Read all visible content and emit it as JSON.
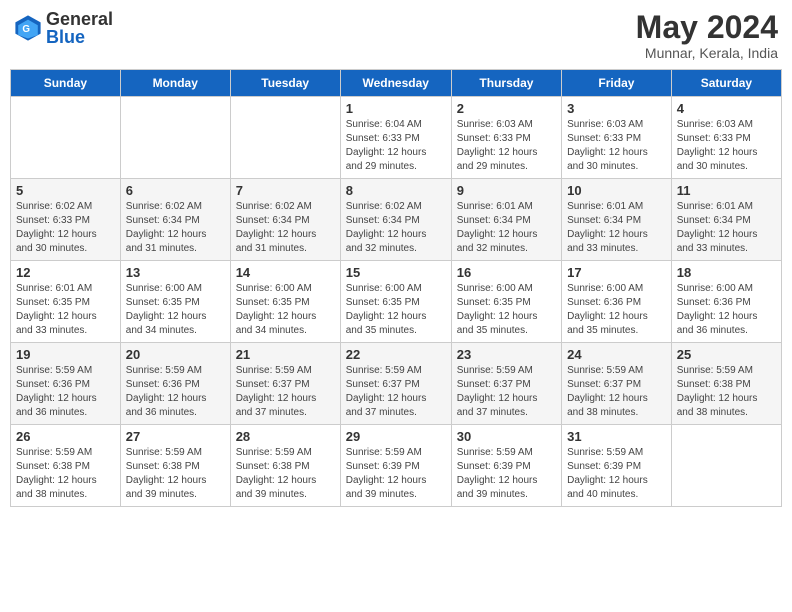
{
  "header": {
    "logo_general": "General",
    "logo_blue": "Blue",
    "month": "May 2024",
    "location": "Munnar, Kerala, India"
  },
  "weekdays": [
    "Sunday",
    "Monday",
    "Tuesday",
    "Wednesday",
    "Thursday",
    "Friday",
    "Saturday"
  ],
  "weeks": [
    [
      {
        "day": "",
        "sunrise": "",
        "sunset": "",
        "daylight": ""
      },
      {
        "day": "",
        "sunrise": "",
        "sunset": "",
        "daylight": ""
      },
      {
        "day": "",
        "sunrise": "",
        "sunset": "",
        "daylight": ""
      },
      {
        "day": "1",
        "sunrise": "Sunrise: 6:04 AM",
        "sunset": "Sunset: 6:33 PM",
        "daylight": "Daylight: 12 hours and 29 minutes."
      },
      {
        "day": "2",
        "sunrise": "Sunrise: 6:03 AM",
        "sunset": "Sunset: 6:33 PM",
        "daylight": "Daylight: 12 hours and 29 minutes."
      },
      {
        "day": "3",
        "sunrise": "Sunrise: 6:03 AM",
        "sunset": "Sunset: 6:33 PM",
        "daylight": "Daylight: 12 hours and 30 minutes."
      },
      {
        "day": "4",
        "sunrise": "Sunrise: 6:03 AM",
        "sunset": "Sunset: 6:33 PM",
        "daylight": "Daylight: 12 hours and 30 minutes."
      }
    ],
    [
      {
        "day": "5",
        "sunrise": "Sunrise: 6:02 AM",
        "sunset": "Sunset: 6:33 PM",
        "daylight": "Daylight: 12 hours and 30 minutes."
      },
      {
        "day": "6",
        "sunrise": "Sunrise: 6:02 AM",
        "sunset": "Sunset: 6:34 PM",
        "daylight": "Daylight: 12 hours and 31 minutes."
      },
      {
        "day": "7",
        "sunrise": "Sunrise: 6:02 AM",
        "sunset": "Sunset: 6:34 PM",
        "daylight": "Daylight: 12 hours and 31 minutes."
      },
      {
        "day": "8",
        "sunrise": "Sunrise: 6:02 AM",
        "sunset": "Sunset: 6:34 PM",
        "daylight": "Daylight: 12 hours and 32 minutes."
      },
      {
        "day": "9",
        "sunrise": "Sunrise: 6:01 AM",
        "sunset": "Sunset: 6:34 PM",
        "daylight": "Daylight: 12 hours and 32 minutes."
      },
      {
        "day": "10",
        "sunrise": "Sunrise: 6:01 AM",
        "sunset": "Sunset: 6:34 PM",
        "daylight": "Daylight: 12 hours and 33 minutes."
      },
      {
        "day": "11",
        "sunrise": "Sunrise: 6:01 AM",
        "sunset": "Sunset: 6:34 PM",
        "daylight": "Daylight: 12 hours and 33 minutes."
      }
    ],
    [
      {
        "day": "12",
        "sunrise": "Sunrise: 6:01 AM",
        "sunset": "Sunset: 6:35 PM",
        "daylight": "Daylight: 12 hours and 33 minutes."
      },
      {
        "day": "13",
        "sunrise": "Sunrise: 6:00 AM",
        "sunset": "Sunset: 6:35 PM",
        "daylight": "Daylight: 12 hours and 34 minutes."
      },
      {
        "day": "14",
        "sunrise": "Sunrise: 6:00 AM",
        "sunset": "Sunset: 6:35 PM",
        "daylight": "Daylight: 12 hours and 34 minutes."
      },
      {
        "day": "15",
        "sunrise": "Sunrise: 6:00 AM",
        "sunset": "Sunset: 6:35 PM",
        "daylight": "Daylight: 12 hours and 35 minutes."
      },
      {
        "day": "16",
        "sunrise": "Sunrise: 6:00 AM",
        "sunset": "Sunset: 6:35 PM",
        "daylight": "Daylight: 12 hours and 35 minutes."
      },
      {
        "day": "17",
        "sunrise": "Sunrise: 6:00 AM",
        "sunset": "Sunset: 6:36 PM",
        "daylight": "Daylight: 12 hours and 35 minutes."
      },
      {
        "day": "18",
        "sunrise": "Sunrise: 6:00 AM",
        "sunset": "Sunset: 6:36 PM",
        "daylight": "Daylight: 12 hours and 36 minutes."
      }
    ],
    [
      {
        "day": "19",
        "sunrise": "Sunrise: 5:59 AM",
        "sunset": "Sunset: 6:36 PM",
        "daylight": "Daylight: 12 hours and 36 minutes."
      },
      {
        "day": "20",
        "sunrise": "Sunrise: 5:59 AM",
        "sunset": "Sunset: 6:36 PM",
        "daylight": "Daylight: 12 hours and 36 minutes."
      },
      {
        "day": "21",
        "sunrise": "Sunrise: 5:59 AM",
        "sunset": "Sunset: 6:37 PM",
        "daylight": "Daylight: 12 hours and 37 minutes."
      },
      {
        "day": "22",
        "sunrise": "Sunrise: 5:59 AM",
        "sunset": "Sunset: 6:37 PM",
        "daylight": "Daylight: 12 hours and 37 minutes."
      },
      {
        "day": "23",
        "sunrise": "Sunrise: 5:59 AM",
        "sunset": "Sunset: 6:37 PM",
        "daylight": "Daylight: 12 hours and 37 minutes."
      },
      {
        "day": "24",
        "sunrise": "Sunrise: 5:59 AM",
        "sunset": "Sunset: 6:37 PM",
        "daylight": "Daylight: 12 hours and 38 minutes."
      },
      {
        "day": "25",
        "sunrise": "Sunrise: 5:59 AM",
        "sunset": "Sunset: 6:38 PM",
        "daylight": "Daylight: 12 hours and 38 minutes."
      }
    ],
    [
      {
        "day": "26",
        "sunrise": "Sunrise: 5:59 AM",
        "sunset": "Sunset: 6:38 PM",
        "daylight": "Daylight: 12 hours and 38 minutes."
      },
      {
        "day": "27",
        "sunrise": "Sunrise: 5:59 AM",
        "sunset": "Sunset: 6:38 PM",
        "daylight": "Daylight: 12 hours and 39 minutes."
      },
      {
        "day": "28",
        "sunrise": "Sunrise: 5:59 AM",
        "sunset": "Sunset: 6:38 PM",
        "daylight": "Daylight: 12 hours and 39 minutes."
      },
      {
        "day": "29",
        "sunrise": "Sunrise: 5:59 AM",
        "sunset": "Sunset: 6:39 PM",
        "daylight": "Daylight: 12 hours and 39 minutes."
      },
      {
        "day": "30",
        "sunrise": "Sunrise: 5:59 AM",
        "sunset": "Sunset: 6:39 PM",
        "daylight": "Daylight: 12 hours and 39 minutes."
      },
      {
        "day": "31",
        "sunrise": "Sunrise: 5:59 AM",
        "sunset": "Sunset: 6:39 PM",
        "daylight": "Daylight: 12 hours and 40 minutes."
      },
      {
        "day": "",
        "sunrise": "",
        "sunset": "",
        "daylight": ""
      }
    ]
  ]
}
